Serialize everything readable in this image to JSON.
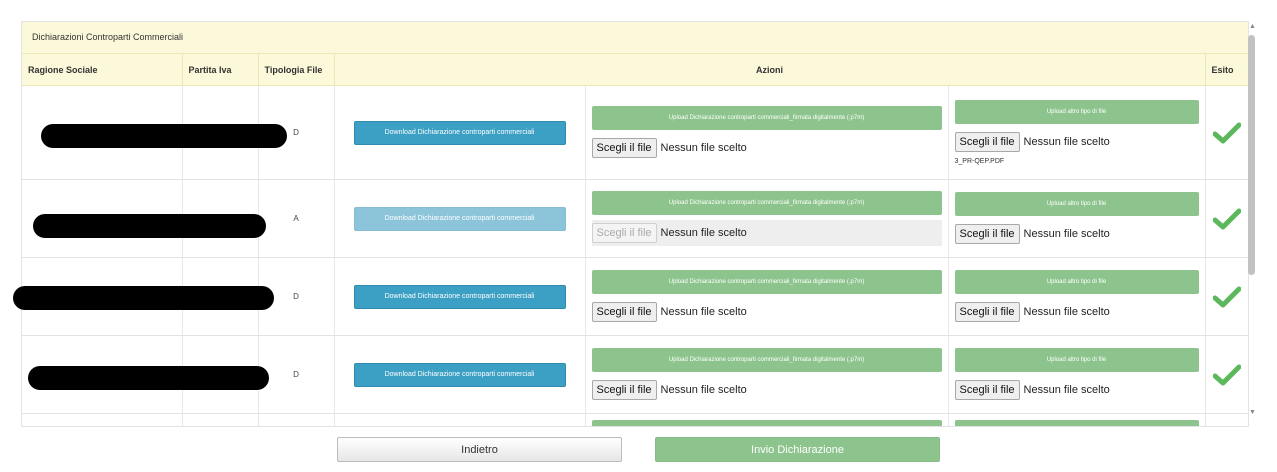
{
  "panel": {
    "title": "Dichiarazioni Controparti Commerciali"
  },
  "columns": {
    "ragione_sociale": "Ragione Sociale",
    "partita_iva": "Partita Iva",
    "tipologia_file": "Tipologia File",
    "azioni": "Azioni",
    "esito": "Esito"
  },
  "rows": [
    {
      "tipologia": "D",
      "download_label": "Download Dichiarazione controparti commerciali",
      "download_enabled": true,
      "upload_dichiarazione_label": "Upload Dichiarazione controparti commerciali_firmata digitalmente (.p7m)",
      "upload_dichiarazione_choose": "Scegli il file",
      "upload_dichiarazione_status": "Nessun file scelto",
      "upload_dichiarazione_enabled": true,
      "upload_altro_label": "Upload altro tipo di file",
      "upload_altro_choose": "Scegli il file",
      "upload_altro_status": "Nessun file scelto",
      "uploaded_file": "3_PR-QEP.PDF",
      "esito_icon": "check-icon"
    },
    {
      "tipologia": "A",
      "download_label": "Download Dichiarazione controparti commerciali",
      "download_enabled": false,
      "upload_dichiarazione_label": "Upload Dichiarazione controparti commerciali_firmata digitalmente (.p7m)",
      "upload_dichiarazione_choose": "Scegli il file",
      "upload_dichiarazione_status": "Nessun file scelto",
      "upload_dichiarazione_enabled": false,
      "upload_altro_label": "Upload altro tipo di file",
      "upload_altro_choose": "Scegli il file",
      "upload_altro_status": "Nessun file scelto",
      "esito_icon": "check-icon"
    },
    {
      "tipologia": "D",
      "download_label": "Download Dichiarazione controparti commerciali",
      "download_enabled": true,
      "upload_dichiarazione_label": "Upload Dichiarazione controparti commerciali_firmata digitalmente (.p7m)",
      "upload_dichiarazione_choose": "Scegli il file",
      "upload_dichiarazione_status": "Nessun file scelto",
      "upload_dichiarazione_enabled": true,
      "upload_altro_label": "Upload altro tipo di file",
      "upload_altro_choose": "Scegli il file",
      "upload_altro_status": "Nessun file scelto",
      "esito_icon": "check-icon"
    },
    {
      "tipologia": "D",
      "download_label": "Download Dichiarazione controparti commerciali",
      "download_enabled": true,
      "upload_dichiarazione_label": "Upload Dichiarazione controparti commerciali_firmata digitalmente (.p7m)",
      "upload_dichiarazione_choose": "Scegli il file",
      "upload_dichiarazione_status": "Nessun file scelto",
      "upload_dichiarazione_enabled": true,
      "upload_altro_label": "Upload altro tipo di file",
      "upload_altro_choose": "Scegli il file",
      "upload_altro_status": "Nessun file scelto",
      "esito_icon": "check-icon"
    }
  ],
  "footer": {
    "back_label": "Indietro",
    "send_label": "Invio Dichiarazione"
  },
  "colors": {
    "header_bg": "#fcf8da",
    "download_blue": "#3c9fc4",
    "upload_green": "#8dc48d",
    "check_green": "#5cb85c"
  }
}
